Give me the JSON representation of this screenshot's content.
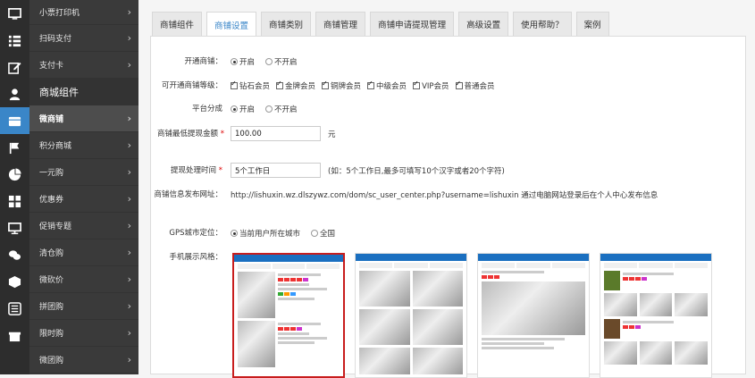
{
  "iconbar": [
    "tv-icon",
    "list-icon",
    "edit-icon",
    "user-icon",
    "shop-icon",
    "flag-icon",
    "pie-chart-icon",
    "grid-icon",
    "monitor-icon",
    "wechat-icon",
    "box-icon",
    "sliders-icon",
    "gift-icon"
  ],
  "menu": {
    "items_top": [
      {
        "label": "小票打印机"
      },
      {
        "label": "扫码支付"
      },
      {
        "label": "支付卡"
      }
    ],
    "group_label": "商城组件",
    "items_group": [
      {
        "label": "微商铺",
        "active": true
      },
      {
        "label": "积分商城"
      },
      {
        "label": "一元购"
      },
      {
        "label": "优惠券"
      },
      {
        "label": "促销专题"
      },
      {
        "label": "清仓购"
      },
      {
        "label": "微砍价"
      },
      {
        "label": "拼团购"
      },
      {
        "label": "限时购"
      },
      {
        "label": "微团购"
      }
    ]
  },
  "tabs": [
    "商铺组件",
    "商铺设置",
    "商铺类别",
    "商铺管理",
    "商铺申请提现管理",
    "高级设置",
    "使用帮助？",
    "案例"
  ],
  "active_tab": 1,
  "form": {
    "open_shop": {
      "label": "开通商铺：",
      "options": [
        "开启",
        "不开启"
      ],
      "selected": 0
    },
    "levels": {
      "label": "可开通商铺等级：",
      "options": [
        "钻石会员",
        "金牌会员",
        "铜牌会员",
        "中级会员",
        "VIP会员",
        "普通会员"
      ]
    },
    "platform_share": {
      "label": "平台分成",
      "options": [
        "开启",
        "不开启"
      ],
      "selected": 0
    },
    "min_withdraw": {
      "label": "商铺最低提现金额",
      "value": "100.00",
      "unit": "元"
    },
    "process_time": {
      "label": "提现处理时间",
      "value": "5个工作日",
      "hint": "(如：5个工作日,最多可填写10个汉字或者20个字符)"
    },
    "publish_url": {
      "label": "商铺信息发布网址：",
      "value": "http://lishuxin.wz.dlszywz.com/dom/sc_user_center.php?username=lishuxin 通过电脑网站登录后在个人中心发布信息"
    },
    "gps": {
      "label": "GPS城市定位：",
      "options": [
        "当前用户所在城市",
        "全国"
      ],
      "selected": 0
    },
    "style": {
      "label": "手机展示风格："
    }
  }
}
